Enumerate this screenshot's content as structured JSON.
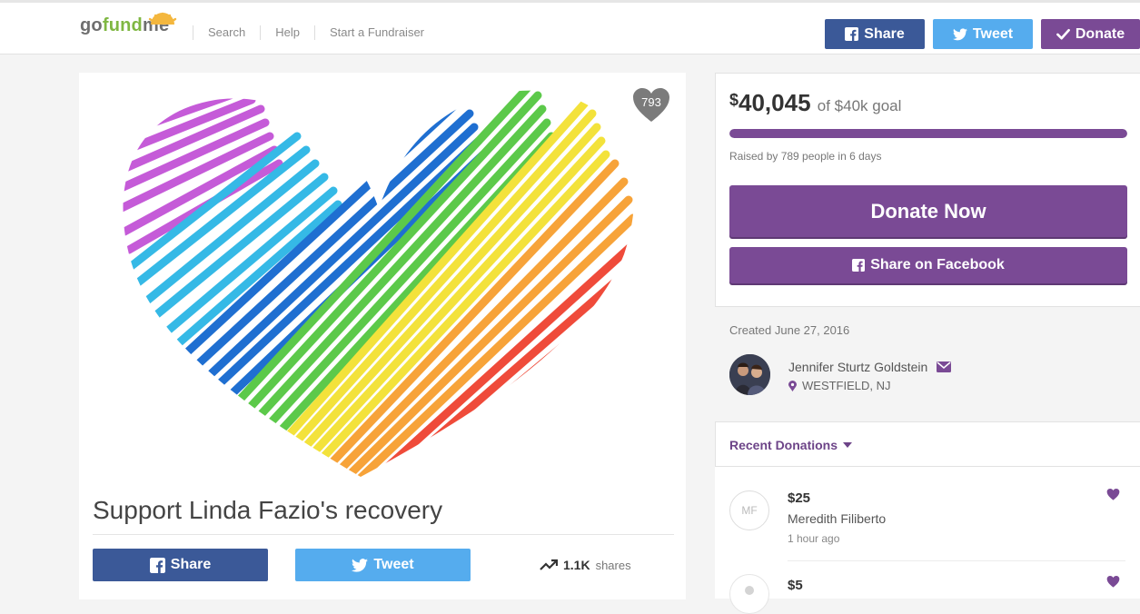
{
  "brand": {
    "logo_go": "go",
    "logo_fund": "fund",
    "logo_me": "me"
  },
  "nav": {
    "links": [
      "Search",
      "Help",
      "Start a Fundraiser"
    ]
  },
  "topbar": {
    "share_label": "Share",
    "tweet_label": "Tweet",
    "donate_label": "Donate"
  },
  "campaign": {
    "hearts": "793",
    "title": "Support Linda Fazio's recovery",
    "share_label": "Share",
    "tweet_label": "Tweet",
    "shares_count": "1.1K",
    "shares_label": "shares"
  },
  "donation_panel": {
    "currency": "$",
    "raised": "40,045",
    "goal_text": "of $40k goal",
    "progress_fraction": 1.0,
    "raised_by": "Raised by 789 people in 6 days",
    "donate_now_label": "Donate Now",
    "share_facebook_label": "Share on Facebook"
  },
  "organizer": {
    "created": "Created June 27, 2016",
    "name": "Jennifer Sturtz Goldstein",
    "location": "WESTFIELD, NJ"
  },
  "recent": {
    "title": "Recent Donations",
    "donations": [
      {
        "initials": "MF",
        "amount": "$25",
        "name": "Meredith Filiberto",
        "time": "1 hour ago"
      },
      {
        "initials": "",
        "amount": "$5",
        "name": "",
        "time": ""
      }
    ]
  },
  "colors": {
    "purple": "#7a4a95",
    "facebook": "#3b5998",
    "twitter": "#55acee",
    "green": "#7fb742"
  }
}
